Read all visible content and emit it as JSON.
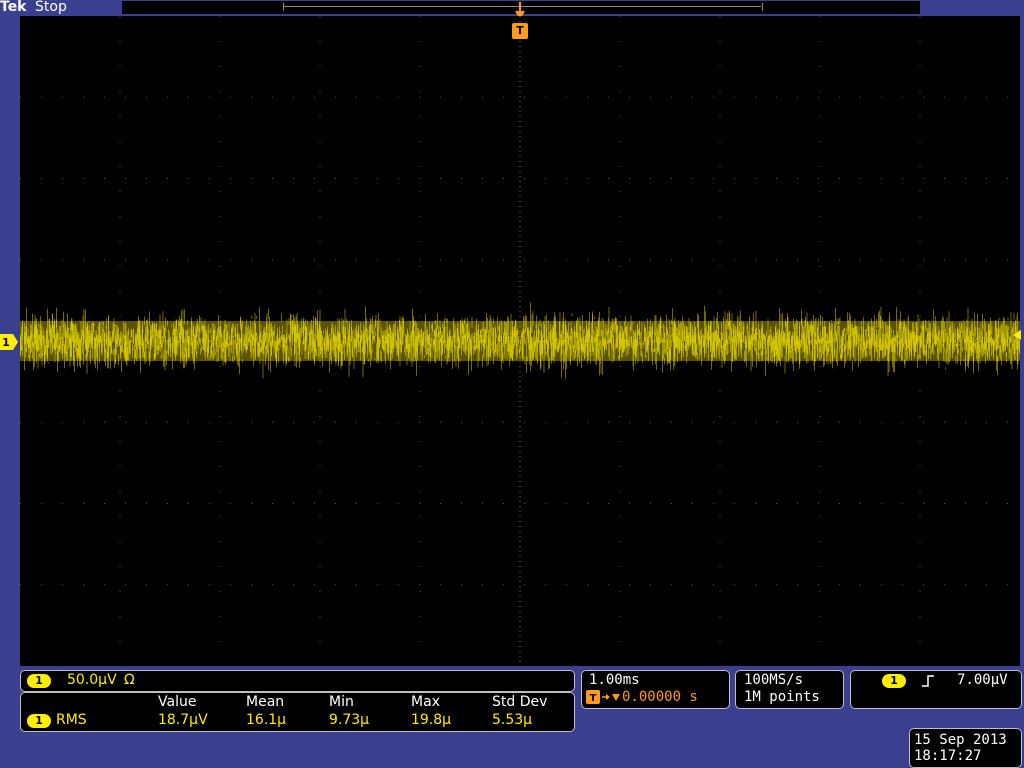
{
  "header": {
    "brand": "Tek",
    "status": "Stop"
  },
  "trigger_marker": {
    "label": "T"
  },
  "channel": {
    "number": "1",
    "scale": "50.0µV",
    "coupling_symbol": "Ω",
    "color": "#ffee00"
  },
  "measurement": {
    "headers": [
      "Value",
      "Mean",
      "Min",
      "Max",
      "Std Dev"
    ],
    "channel": "1",
    "name": "RMS",
    "values": [
      "18.7µV",
      "16.1µ",
      "9.73µ",
      "19.8µ",
      "5.53µ"
    ]
  },
  "timebase": {
    "scale": "1.00ms",
    "delay": "0.00000 s"
  },
  "sampling": {
    "rate": "100MS/s",
    "record_length": "1M points"
  },
  "trigger": {
    "channel": "1",
    "slope_icon": "rising-edge-icon",
    "level": "7.00µV"
  },
  "datetime": {
    "date": "15 Sep 2013",
    "time": "18:17:27"
  },
  "colors": {
    "background": "#3a3f8f",
    "trace": "#ffee00",
    "trigger": "#ff9a1a",
    "grid": "#5a5a5a"
  }
}
